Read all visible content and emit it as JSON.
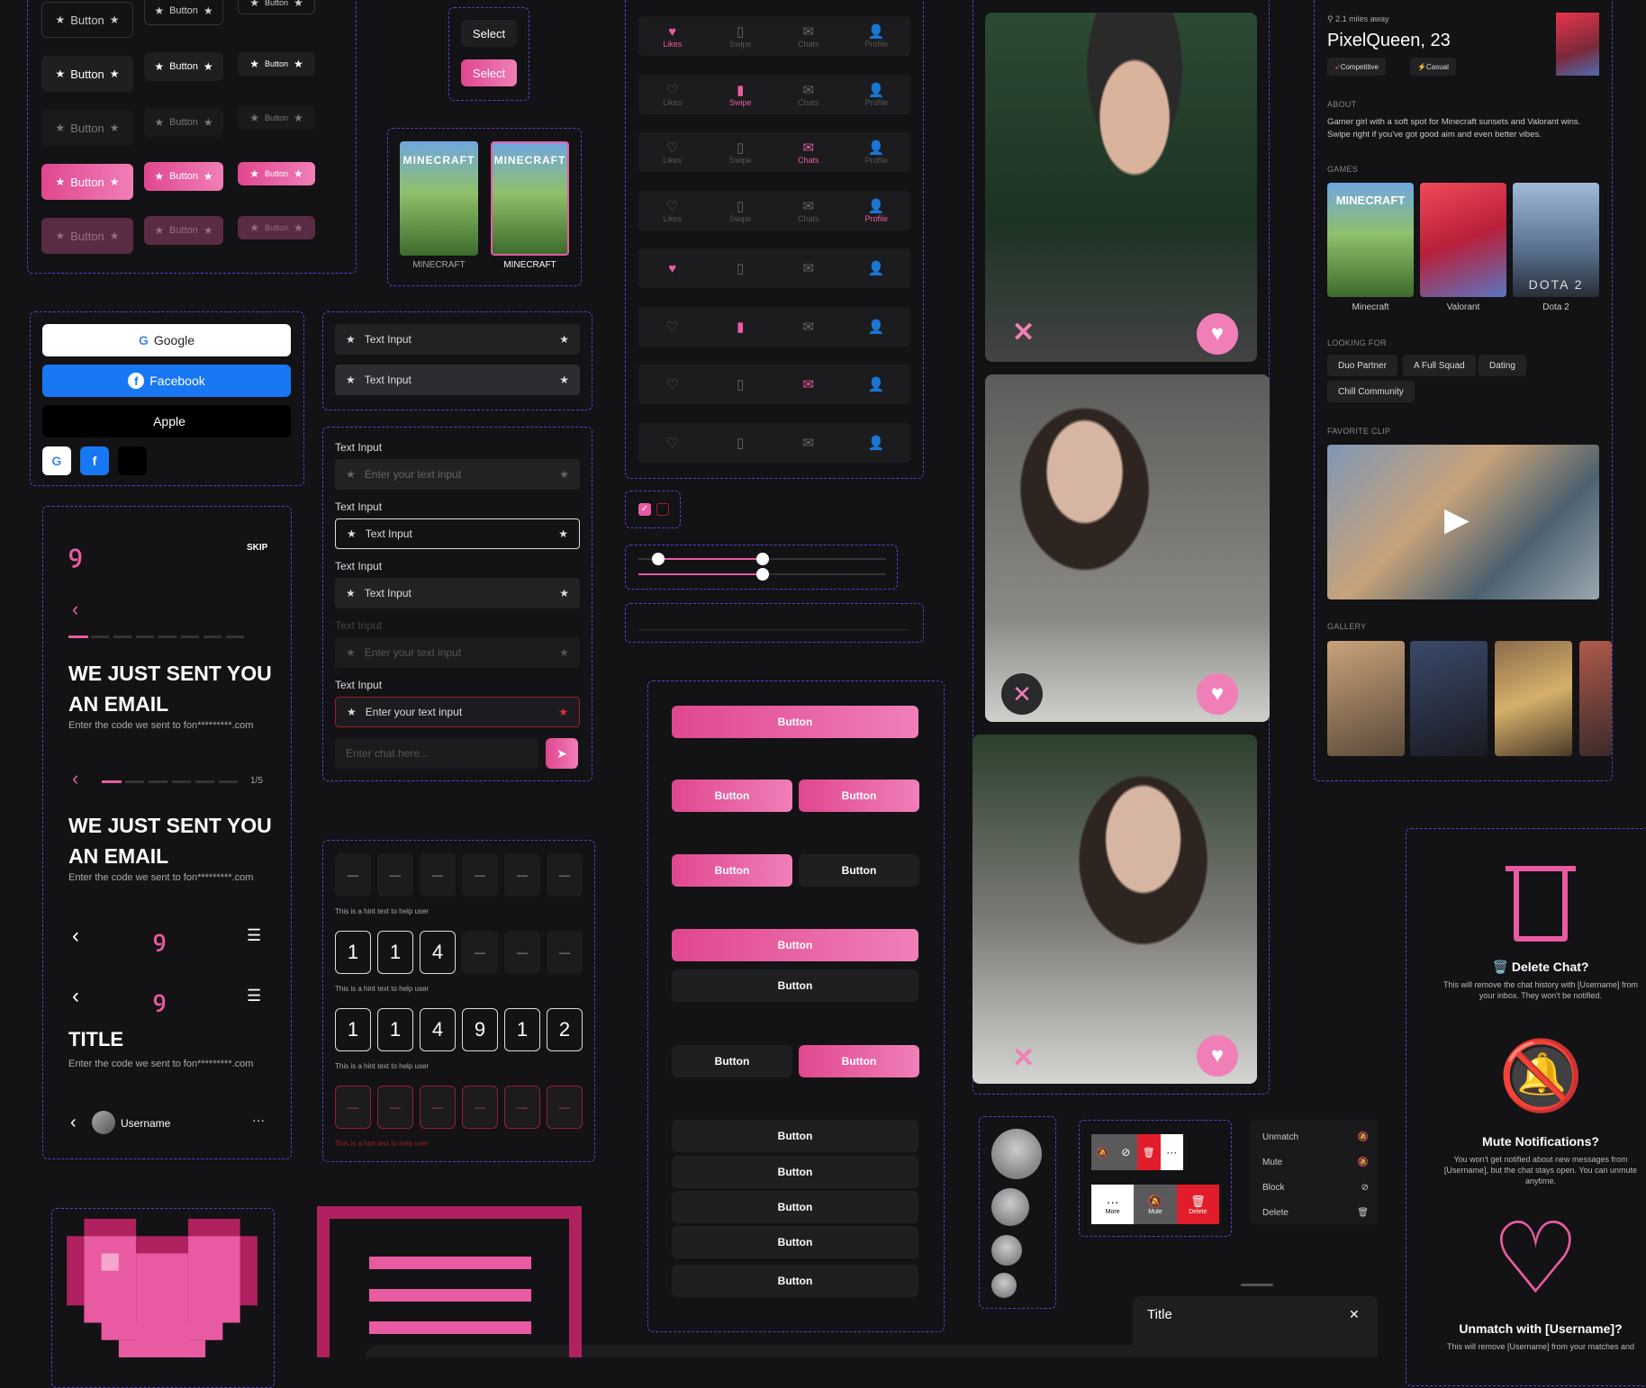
{
  "buttons": {
    "label": "Button"
  },
  "select": {
    "label1": "Select",
    "label2": "Select"
  },
  "games_small": {
    "a": "MINECRAFT",
    "b": "MINECRAFT"
  },
  "social": {
    "google": "Google",
    "facebook": "Facebook",
    "apple": "Apple"
  },
  "inputs": {
    "text_input": "Text Input",
    "placeholder": "Enter your text input",
    "chat_placeholder": "Enter chat here..."
  },
  "nav": {
    "likes": "Likes",
    "swipe": "Swipe",
    "chats": "Chats",
    "profile": "Profile"
  },
  "onboarding": {
    "skip": "SKIP",
    "heading_l1": "WE JUST SENT YOU",
    "heading_l2": "AN EMAIL",
    "sub": "Enter the code we sent to fon*********.com",
    "step": "1/5",
    "title": "TITLE",
    "username": "Username"
  },
  "otp": {
    "hint": "This is a hint text to help user",
    "row2": [
      "1",
      "1",
      "4"
    ],
    "row3": [
      "1",
      "1",
      "4",
      "9",
      "1",
      "2"
    ],
    "empty": "–"
  },
  "profile": {
    "distance": "2.1 miles away",
    "name": "PixelQueen, 23",
    "tag1": "Competitive",
    "tag2": "Casual",
    "about_h": "ABOUT",
    "about": "Gamer girl with a soft spot for Minecraft sunsets and Valorant wins. Swipe right if you've got good aim and even better vibes.",
    "games_h": "GAMES",
    "games": [
      "Minecraft",
      "Valorant",
      "Dota 2"
    ],
    "looking_h": "LOOKING FOR",
    "looking": [
      "Duo Partner",
      "A Full Squad",
      "Dating",
      "Chill Community"
    ],
    "clip_h": "FAVORITE CLIP",
    "gallery_h": "GALLERY"
  },
  "actions": {
    "more": "More",
    "mute": "Mute",
    "delete": "Delete"
  },
  "menu": [
    "Unmatch",
    "Mute",
    "Block",
    "Delete"
  ],
  "sheets": {
    "delete_t": "🗑️ Delete Chat?",
    "delete_d": "This will remove the chat history with [Username] from your inbox. They won't be notified.",
    "mute_t": "Mute Notifications?",
    "mute_d": "You won't get notified about new messages from [Username], but the chat stays open. You can unmute anytime.",
    "unmatch_t": "Unmatch with [Username]?",
    "unmatch_d": "This will remove [Username] from your matches and"
  },
  "modal": {
    "title": "Title"
  },
  "colors": {
    "pink": "#e85ba2",
    "bg": "#131214",
    "dash": "#5b3fd6"
  }
}
